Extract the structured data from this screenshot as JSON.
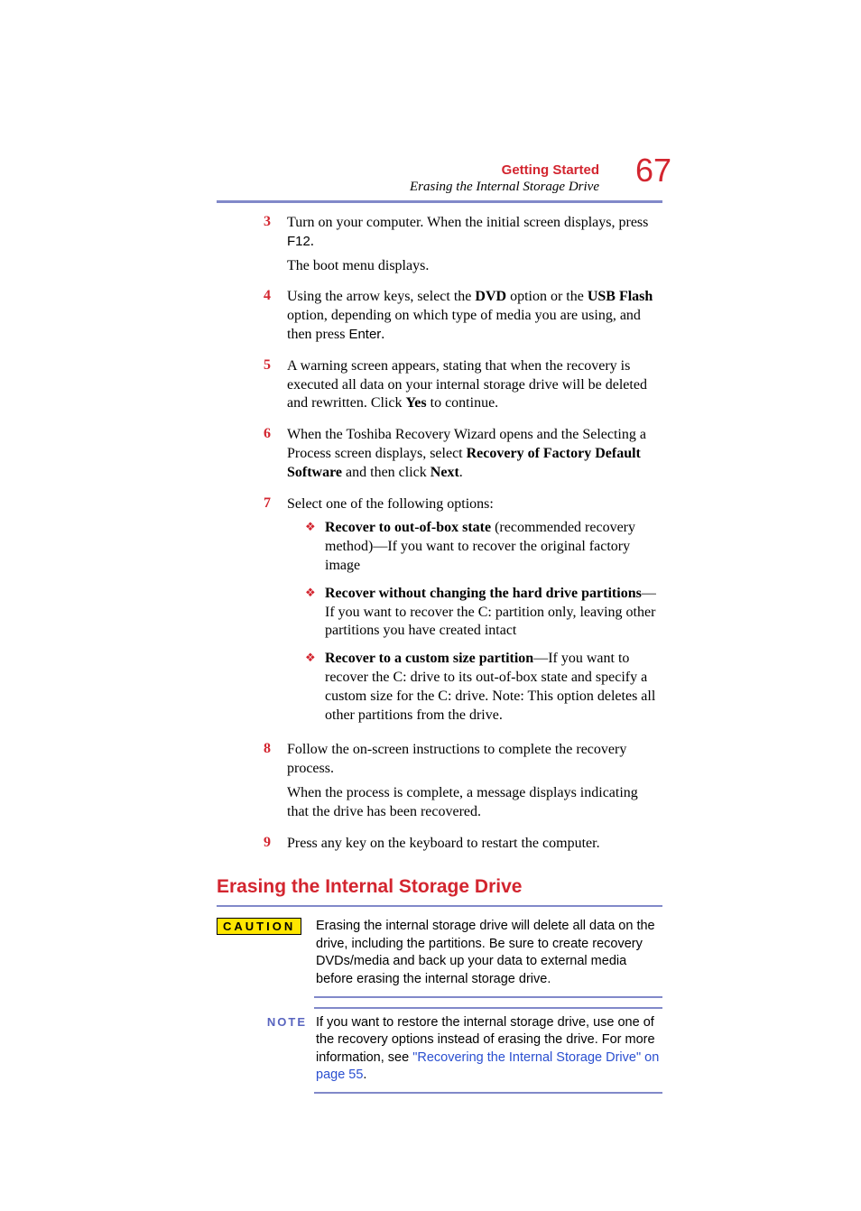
{
  "header": {
    "chapter": "Getting Started",
    "section": "Erasing the Internal Storage Drive",
    "pageNumber": "67"
  },
  "steps": {
    "s3": {
      "num": "3",
      "p1a": "Turn on your computer. When the initial screen displays, press ",
      "key": "F12",
      "p1b": ".",
      "p2": "The boot menu displays."
    },
    "s4": {
      "num": "4",
      "p1a": "Using the arrow keys, select the ",
      "b1": "DVD",
      "p1b": " option or the ",
      "b2": "USB Flash",
      "p1c": " option, depending on which type of media you are using, and then press ",
      "key": "Enter",
      "p1d": "."
    },
    "s5": {
      "num": "5",
      "p1a": "A warning screen appears, stating that when the recovery is executed all data on your internal storage drive will be deleted and rewritten. Click ",
      "b1": "Yes",
      "p1b": " to continue."
    },
    "s6": {
      "num": "6",
      "p1a": "When the Toshiba Recovery Wizard opens and the Selecting a Process screen displays, select ",
      "b1": "Recovery of Factory Default Software",
      "p1b": " and then click ",
      "b2": "Next",
      "p1c": "."
    },
    "s7": {
      "num": "7",
      "p1": "Select one of the following options:",
      "bullets": {
        "b1": {
          "bold": "Recover to out-of-box state",
          "rest": " (recommended recovery method)—If you want to recover the original factory image"
        },
        "b2": {
          "bold": "Recover without changing the hard drive partitions",
          "rest": "—If you want to recover the C: partition only, leaving other partitions you have created intact"
        },
        "b3": {
          "bold": "Recover to a custom size partition",
          "rest": "—If you want to recover the C: drive to its out-of-box state and specify a custom size for the C: drive. Note: This option deletes all other partitions from the drive."
        }
      }
    },
    "s8": {
      "num": "8",
      "p1": "Follow the on-screen instructions to complete the recovery process.",
      "p2": "When the process is complete, a message displays indicating that the drive has been recovered."
    },
    "s9": {
      "num": "9",
      "p1": "Press any key on the keyboard to restart the computer."
    }
  },
  "heading": "Erasing the Internal Storage Drive",
  "caution": {
    "label": "CAUTION",
    "body": "Erasing the internal storage drive will delete all data on the drive, including the partitions. Be sure to create recovery DVDs/media and back up your data to external media before erasing the internal storage drive."
  },
  "note": {
    "label": "NOTE",
    "pre": "If you want to restore the internal storage drive, use one of the recovery options instead of erasing the drive. For more information, see ",
    "link": "\"Recovering the Internal Storage Drive\" on page 55",
    "post": "."
  }
}
